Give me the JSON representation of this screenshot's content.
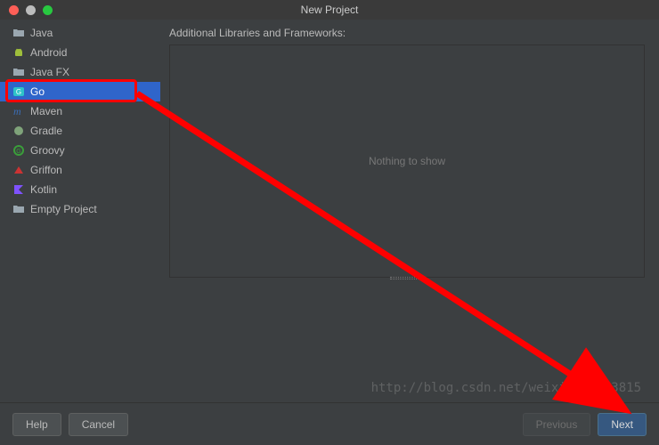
{
  "window": {
    "title": "New Project"
  },
  "sidebar": {
    "items": [
      {
        "label": "Java",
        "icon": "folder",
        "color": "#9aa7b0"
      },
      {
        "label": "Android",
        "icon": "android",
        "color": "#9fbf3b"
      },
      {
        "label": "Java FX",
        "icon": "folder",
        "color": "#9aa7b0"
      },
      {
        "label": "Go",
        "icon": "go",
        "color": "#2ec4c8",
        "selected": true
      },
      {
        "label": "Maven",
        "icon": "m",
        "color": "#3b6db5"
      },
      {
        "label": "Gradle",
        "icon": "gradle",
        "color": "#7fa37a"
      },
      {
        "label": "Groovy",
        "icon": "groovy",
        "color": "#3a9e3a"
      },
      {
        "label": "Griffon",
        "icon": "griffon",
        "color": "#cc3333"
      },
      {
        "label": "Kotlin",
        "icon": "kotlin",
        "color": "#7f52ff"
      },
      {
        "label": "Empty Project",
        "icon": "folder",
        "color": "#9aa7b0"
      }
    ]
  },
  "main": {
    "libraries_label": "Additional Libraries and Frameworks:",
    "empty_text": "Nothing to show"
  },
  "footer": {
    "help": "Help",
    "cancel": "Cancel",
    "previous": "Previous",
    "next": "Next"
  },
  "watermark": "http://blog.csdn.net/weixin_40133815",
  "annotation": {
    "highlight_item_index": 3,
    "arrow_from": "sidebar Go item",
    "arrow_to": "Next button"
  }
}
